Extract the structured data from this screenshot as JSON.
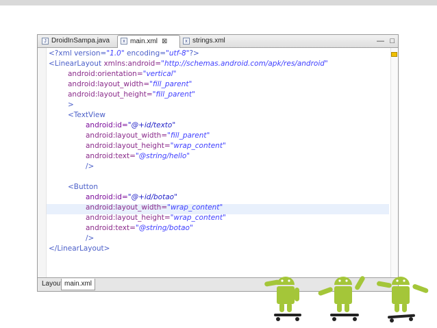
{
  "editor": {
    "tabs": [
      {
        "label": "DroidInSampa.java",
        "icon": "java-file-icon"
      },
      {
        "label": "main.xml",
        "icon": "xml-file-icon",
        "active": true,
        "close": "⊠"
      },
      {
        "label": "strings.xml",
        "icon": "xml-file-icon"
      }
    ],
    "minimize": "—",
    "maximize": "□"
  },
  "bottom_tabs": [
    {
      "label": "Layout"
    },
    {
      "label": "main.xml",
      "active": true
    }
  ],
  "code": {
    "l1": [
      "<?xml version=",
      "\"1.0\"",
      " encoding=",
      "\"utf-8\"",
      "?>"
    ],
    "l2": [
      "<LinearLayout",
      " xmlns:android=",
      "\"http://schemas.android.com/apk/res/android\""
    ],
    "l3": [
      "android:orientation=",
      "\"vertical\""
    ],
    "l4": [
      "android:layout_width=",
      "\"fill_parent\""
    ],
    "l5": [
      "android:layout_height=",
      "\"fill_parent\""
    ],
    "l6": ">",
    "l7": "<TextView",
    "l8": [
      "android:id=",
      "\"@+id/texto\""
    ],
    "l9": [
      "android:layout_width=",
      "\"fill_parent\""
    ],
    "l10": [
      "android:layout_height=",
      "\"wrap_content\""
    ],
    "l11": [
      "android:text=",
      "\"@string/hello\""
    ],
    "l12": "/>",
    "l14": "<Button",
    "l15": [
      "android:id=",
      "\"@+id/botao\""
    ],
    "l16": [
      "android:layout_width=",
      "\"wrap_content\""
    ],
    "l17": [
      "android:layout_height=",
      "\"wrap_content\""
    ],
    "l18": [
      "android:text=",
      "\"@string/botao\""
    ],
    "l19": "/>",
    "l20": "</LinearLayout>"
  },
  "colors": {
    "android_green": "#a4c639",
    "highlight_line": "#e8f0fc"
  }
}
